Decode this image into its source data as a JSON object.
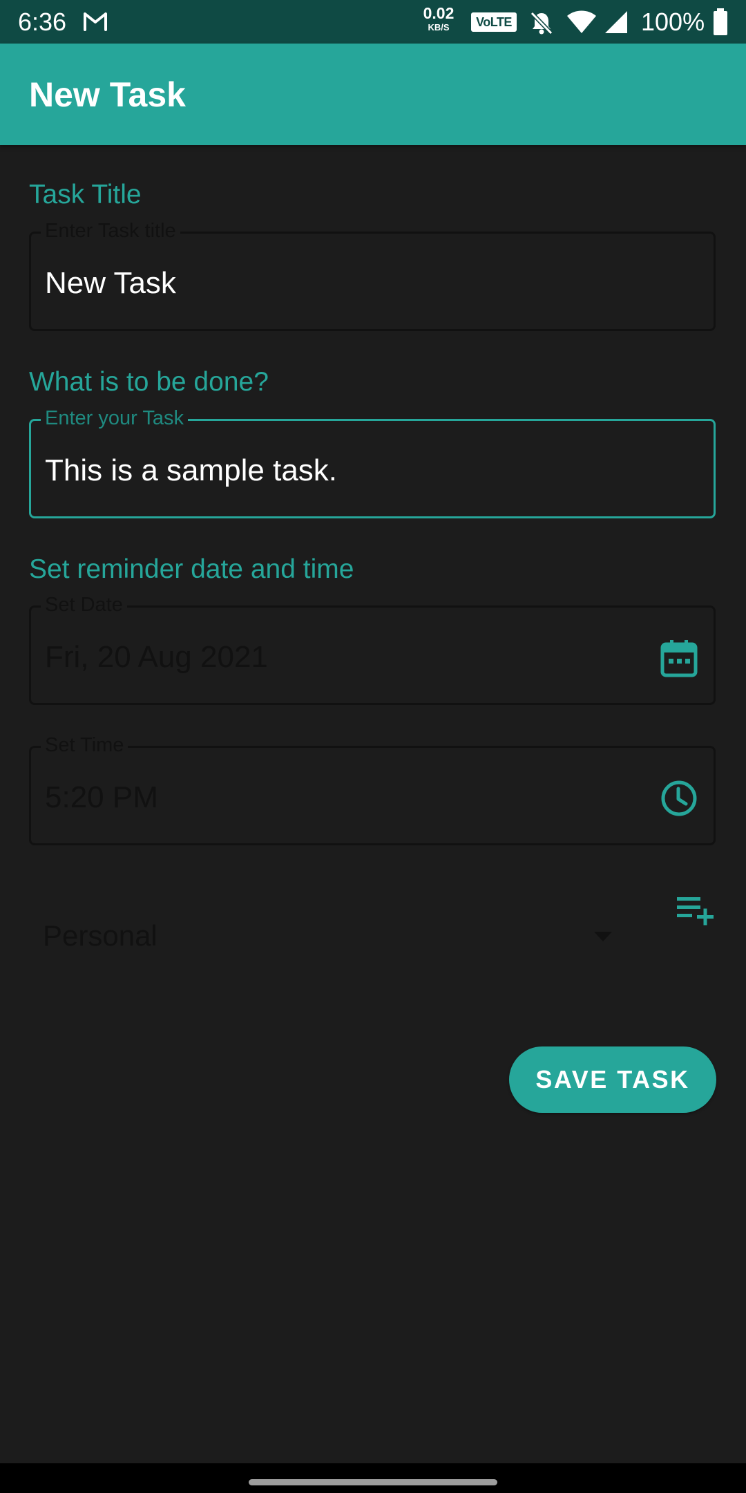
{
  "status_bar": {
    "time": "6:36",
    "net_speed_value": "0.02",
    "net_speed_unit": "KB/S",
    "volte": "VoLTE",
    "battery": "100%",
    "icons": [
      "gmail-icon",
      "bell-off-icon",
      "wifi-icon",
      "signal-icon",
      "battery-icon"
    ]
  },
  "app_bar": {
    "title": "New Task"
  },
  "form": {
    "title_section": {
      "label": "Task Title",
      "hint": "Enter Task title",
      "value": "New Task"
    },
    "task_section": {
      "label": "What is to be done?",
      "hint": "Enter your Task",
      "value": "This is a sample task.",
      "focused": true
    },
    "reminder_section": {
      "label": "Set reminder date and time",
      "date_hint": "Set Date",
      "date_value": "Fri, 20 Aug 2021",
      "date_icon": "calendar-icon",
      "time_hint": "Set Time",
      "time_value": "5:20 PM",
      "time_icon": "clock-icon"
    },
    "category": {
      "selected": "Personal",
      "add_icon": "playlist-add-icon"
    },
    "save_label": "SAVE TASK"
  },
  "colors": {
    "accent": "#26a69a",
    "status_bar": "#0f4a44",
    "background": "#1c1c1c"
  }
}
